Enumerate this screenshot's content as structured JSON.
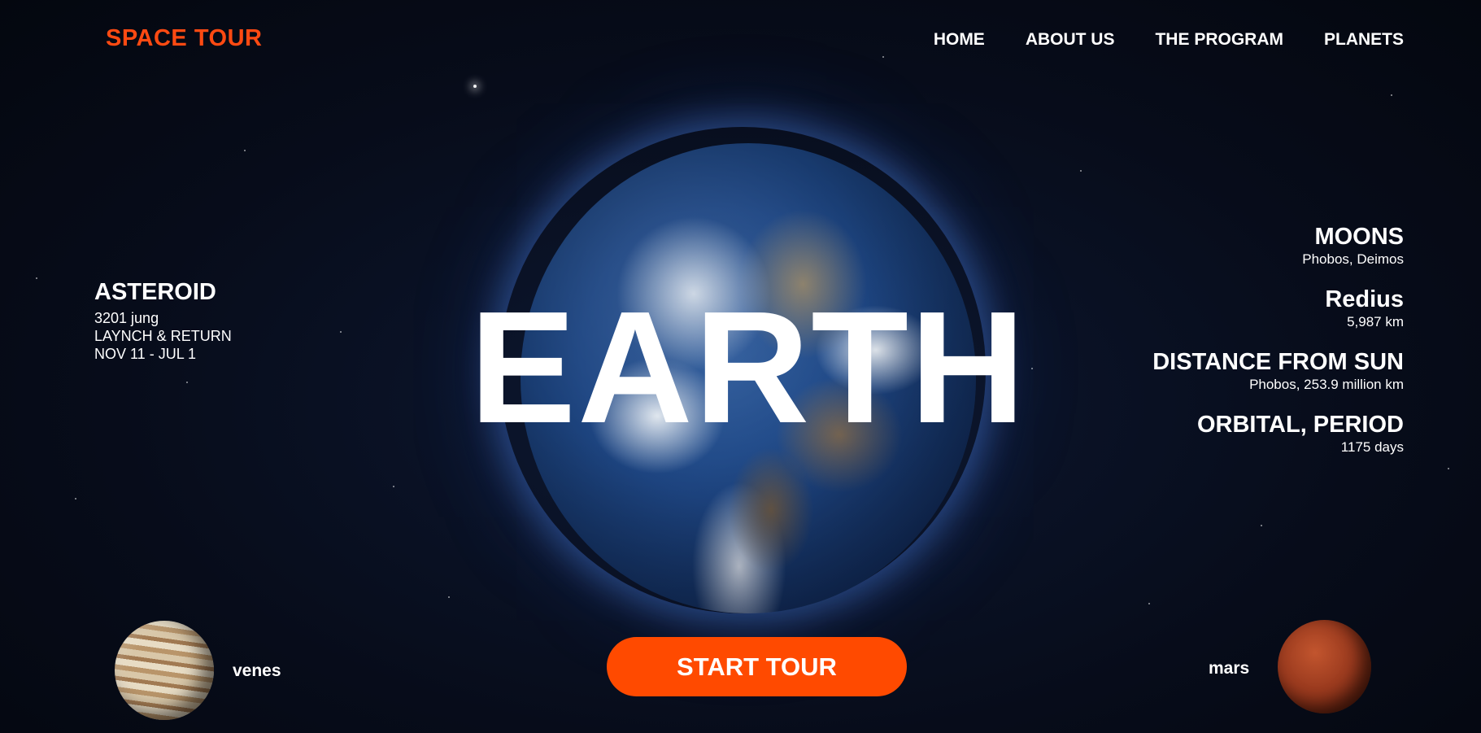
{
  "brand": {
    "logo": "SPACE TOUR"
  },
  "nav": {
    "items": [
      {
        "label": "HOME"
      },
      {
        "label": "ABOUT US"
      },
      {
        "label": "THE PROGRAM"
      },
      {
        "label": "PLANETS"
      }
    ]
  },
  "hero": {
    "title": "EARTH",
    "cta_label": "START TOUR"
  },
  "asteroid": {
    "heading": "ASTEROID",
    "lines": [
      "3201 jung",
      "LAYNCH & RETURN",
      "NOV 11 - JUL 1"
    ]
  },
  "stats": [
    {
      "heading": "MOONS",
      "value": "Phobos, Deimos"
    },
    {
      "heading": "Redius",
      "value": "5,987 km"
    },
    {
      "heading": "DISTANCE FROM SUN",
      "value": "Phobos, 253.9 million km"
    },
    {
      "heading": "ORBITAL, PERIOD",
      "value": "1175 days"
    }
  ],
  "planets": {
    "left": {
      "label": "venes"
    },
    "right": {
      "label": "mars"
    }
  },
  "colors": {
    "accent": "#ff4a00",
    "logo": "#ff4a12",
    "text": "#ffffff",
    "background": "#070c1a"
  }
}
